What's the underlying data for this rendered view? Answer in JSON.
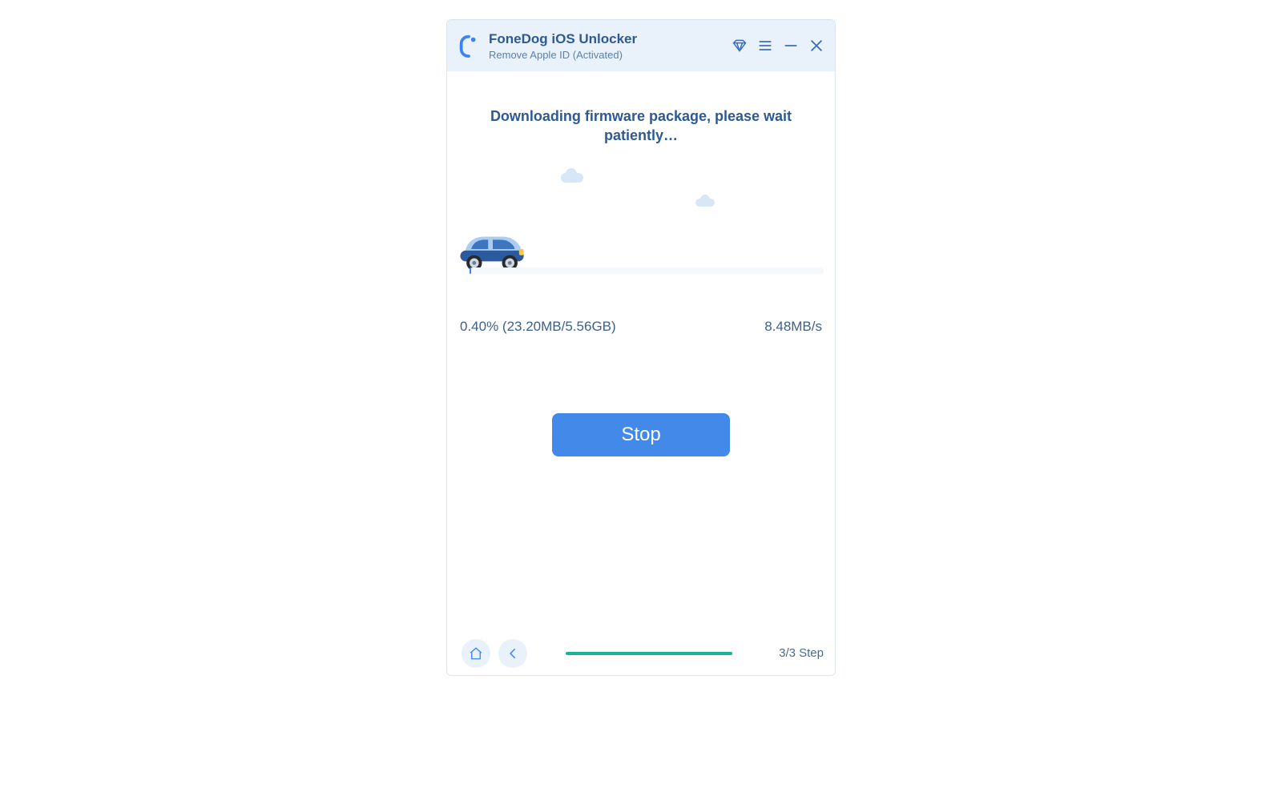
{
  "header": {
    "app_title": "FoneDog iOS Unlocker",
    "subtitle": "Remove Apple ID  (Activated)"
  },
  "content": {
    "status_heading": "Downloading firmware package, please wait patiently…",
    "progress_text": "0.40% (23.20MB/5.56GB)",
    "speed_text": "8.48MB/s",
    "stop_label": "Stop"
  },
  "footer": {
    "step_label": "3/3 Step"
  },
  "icons": {
    "logo": "fonedog-logo",
    "diamond": "diamond-icon",
    "menu": "menu-icon",
    "minimize": "minimize-icon",
    "close": "close-icon",
    "home": "home-icon",
    "back": "chevron-left-icon"
  },
  "colors": {
    "accent": "#3b82f6",
    "text_primary": "#2d5a93",
    "progress_done": "#17b39a"
  }
}
